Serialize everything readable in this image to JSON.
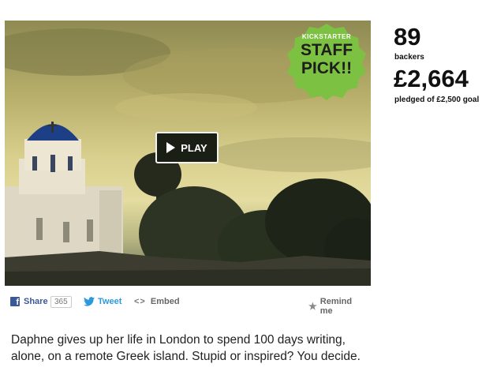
{
  "video": {
    "badge": {
      "line1": "KICKSTARTER",
      "line2": "STAFF",
      "line3": "PICK!!"
    },
    "play_label": "PLAY"
  },
  "stats": {
    "backers_count": "89",
    "backers_label": "backers",
    "pledged_amount": "£2,664",
    "pledged_label": "pledged of £2,500 goal"
  },
  "share": {
    "facebook_label": "Share",
    "facebook_count": "365",
    "twitter_label": "Tweet",
    "embed_label": "Embed",
    "remind_label": "Remind me"
  },
  "blurb": "Daphne gives up her life in London to spend 100 days writing, alone, on a remote Greek island. Stupid or inspired? You decide.",
  "colors": {
    "badge_green": "#7dc142",
    "facebook_blue": "#3b5998",
    "twitter_blue": "#2a9ae0"
  }
}
